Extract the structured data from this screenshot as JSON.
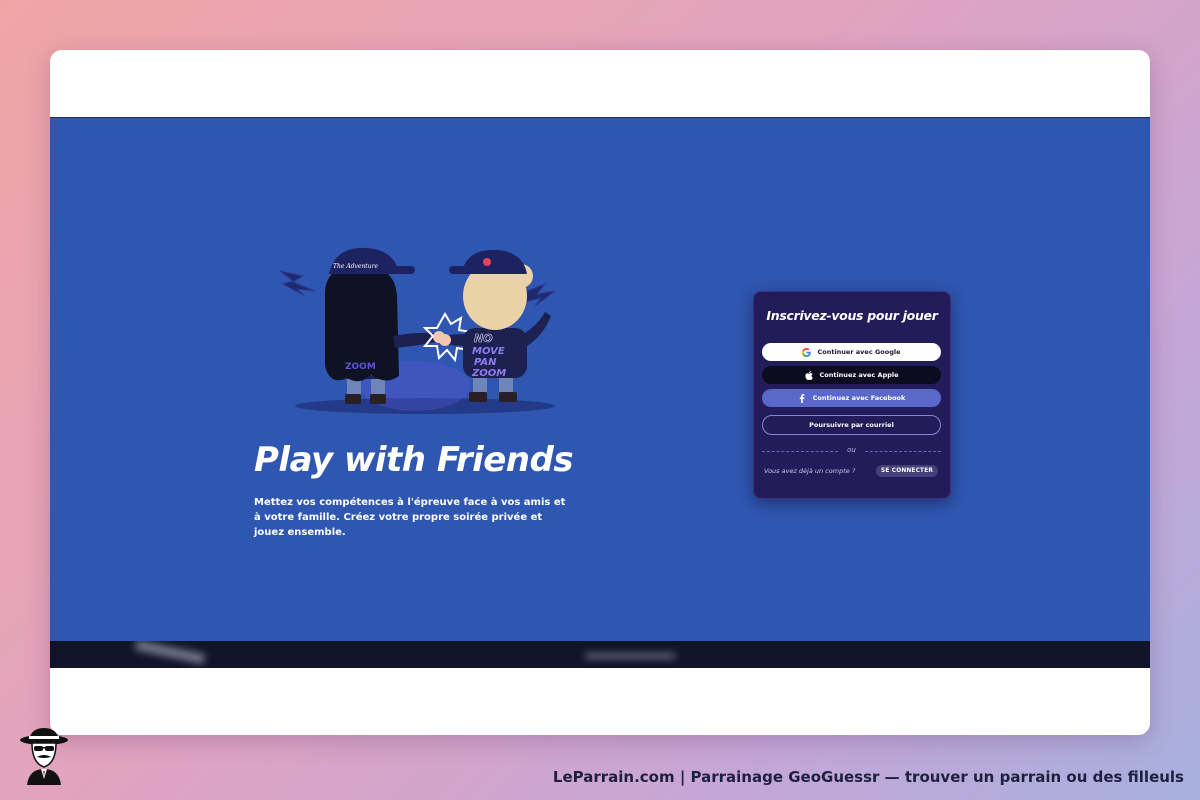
{
  "hero": {
    "title": "Play with Friends",
    "description": "Mettez vos compétences à l'épreuve face à vos amis et à votre famille. Créez votre propre soirée privée et jouez ensemble."
  },
  "illustration": {
    "cap_text": "The Adventure",
    "shirt_text": [
      "NO",
      "MOVE",
      "PAN",
      "ZOOM"
    ],
    "back_text": "ZOOM"
  },
  "signup": {
    "title": "Inscrivez-vous pour jouer",
    "google_label": "Continuer avec Google",
    "apple_label": "Continuez avec Apple",
    "facebook_label": "Continuez avec Facebook",
    "email_label": "Poursuivre par courriel",
    "divider_text": "ou",
    "already_text": "Vous avez déjà un compte ?",
    "login_label": "SE CONNECTER"
  },
  "footer": {
    "caption": "LeParrain.com | Parrainage GeoGuessr — trouver un parrain ou des filleuls"
  },
  "colors": {
    "hero_bg": "#2f56b0",
    "panel_bg": "#241c5a",
    "facebook_btn": "#5a68c9",
    "dark_strip": "#11132a"
  }
}
